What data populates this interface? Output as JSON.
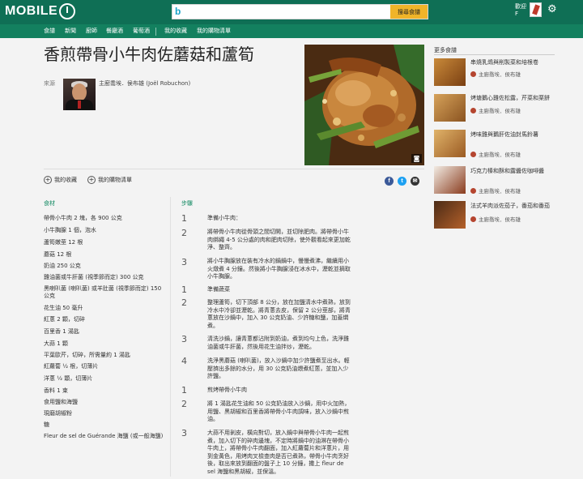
{
  "header": {
    "logo_text": "MOBILE",
    "search_button": "搜尋食譜",
    "user_name": "歡迎",
    "user_initial": "F"
  },
  "nav": [
    "食譜",
    "新聞",
    "廚師",
    "餐廳酒",
    "葡萄酒",
    "我的收藏",
    "我的購物清單"
  ],
  "recipe": {
    "title": "香煎帶骨小牛肉佐蘑菇和蘆筍",
    "source_label": "來源",
    "author": "主廚喬埃．侯布雄 (Joël Robuchon)",
    "actions": [
      "我的收藏",
      "我的購物清單"
    ],
    "ingredients_heading": "食材",
    "steps_heading": "步驟",
    "ingredients": [
      "帶骨小牛肉 2 塊，各 900 公克",
      "小牛胸腺 1 個，泡水",
      "蘆筍嫩莖 12 根",
      "蘑菇 12 根",
      "奶油 250 公克",
      "雞油菌或牛肝菌 (視季節而定) 300 公克",
      "黑喇叭菌 (喇叭菌) 或羊肚菌 (視季節而定) 150 公克",
      "花生油 50 毫升",
      "紅蔥 2 顆，切碎",
      "百里香 1 湯匙",
      "大蒜 1 顆",
      "平葉歐芹，切碎，所需量約 1 湯匙",
      "紅蘿蔔 ½ 根，切薄片",
      "洋蔥 ½ 顆，切薄片",
      "香料 1 束",
      "食用鹽和海鹽",
      "現磨胡椒粉",
      "糖",
      "Fleur de sel de Guérande 海鹽 (或一般海鹽)"
    ],
    "steps": [
      {
        "num": "1",
        "text": "準備小牛肉："
      },
      {
        "num": "2",
        "text": "將帶骨小牛肉從骨頭之間切開，並切除肥肉。將帶骨小牛肉綁繩 4-5 公分處的肉和肥肉切除，使外觀看起來更加乾淨、整齊。"
      },
      {
        "num": "3",
        "text": "將小牛胸腺放在裝有冷水的鍋鍋中，慢慢煮沸，繼續用小火燉煮 4 分鐘。然後將小牛胸腺浸在冰水中，瀝乾並摘取小牛胸腺。"
      },
      {
        "num": "1",
        "text": "準備蔬菜"
      },
      {
        "num": "2",
        "text": "整理蘆筍，切下頂部 8 公分，放在加鹽清水中煮熟，放到冷水中冷卻並瀝乾。將青蔥去皮，保留 2 公分莖部，將青蔥放在沙鍋中，加入 30 公克奶油、少許糖和鹽，加蓋燜煮。"
      },
      {
        "num": "3",
        "text": "清洗沙鍋，讓青蔥都沾附到奶油，煮到均勻上色，洗淨雞油菌或牛肝菌，然後用花生油拌炒，瀝乾。"
      },
      {
        "num": "4",
        "text": "洗淨黑蘑菇 (喇叭菌)，放入沙鍋中加少許鹽煮至出水。輕壓擠出多餘的水分，用 30 公克奶油煨煮紅蔥，並加入少許鹽。"
      },
      {
        "num": "1",
        "text": "煎烤帶骨小牛肉"
      },
      {
        "num": "2",
        "text": "將 1 湯匙花生油和 50 公克奶油放入沙鍋，用中火加熱，用鹽、黑胡椒和百里香將帶骨小牛肉調味，放入沙鍋中煎油。"
      },
      {
        "num": "3",
        "text": "大蒜不用剝皮，橫向對切，放入鍋中與帶骨小牛肉一起煎煮，加入切下的碎肉邊塊，不定時將鍋中的油淋在帶骨小牛肉上，將帶骨小牛肉翻面，加入紅蘿蔔片和洋蔥片，用到金黃色，用烤肉叉檢查肉是否已煮熟，帶骨小牛肉烹好後，取出來放到翻面的盤子上 10 分鐘，撒上 fleur de sel 海鹽和黑胡椒，並保溫。"
      }
    ]
  },
  "sidebar": {
    "title": "更多食譜",
    "items": [
      {
        "title": "串燒乳鴿與削製菜和培根卷",
        "author": "主廚喬埃．侯布雄"
      },
      {
        "title": "烤塘鵝心雞佐松露，芹菜和栗餅",
        "author": "主廚喬埃．侯布雄"
      },
      {
        "title": "烤味雞與鵝肝佐油封馬鈴薯",
        "author": "主廚喬埃．侯布雄"
      },
      {
        "title": "巧克力榛和酥和露醬佐咖啡醬",
        "author": "主廚喬埃．侯布雄"
      },
      {
        "title": "法式羊肉派佐茄子，番茄和番茄",
        "author": "主廚喬埃．侯布雄"
      }
    ]
  }
}
